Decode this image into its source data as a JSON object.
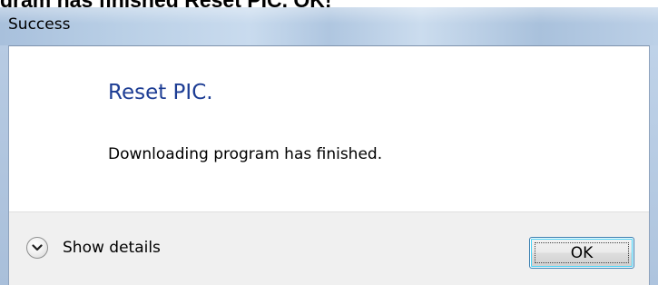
{
  "document": {
    "heading": "gram has finished Reset PIC. OK!"
  },
  "dialog": {
    "title": "Success",
    "instruction": "Reset PIC.",
    "message": "Downloading program has finished.",
    "details_label": "Show details",
    "ok_label": "OK",
    "details_icon": "chevron-down-icon"
  },
  "colors": {
    "instruction_text": "#1d3d94",
    "footer_background": "#f0f0f0",
    "title_bar": "#b9cfe6",
    "button_focus_border": "#3c7fb1"
  }
}
